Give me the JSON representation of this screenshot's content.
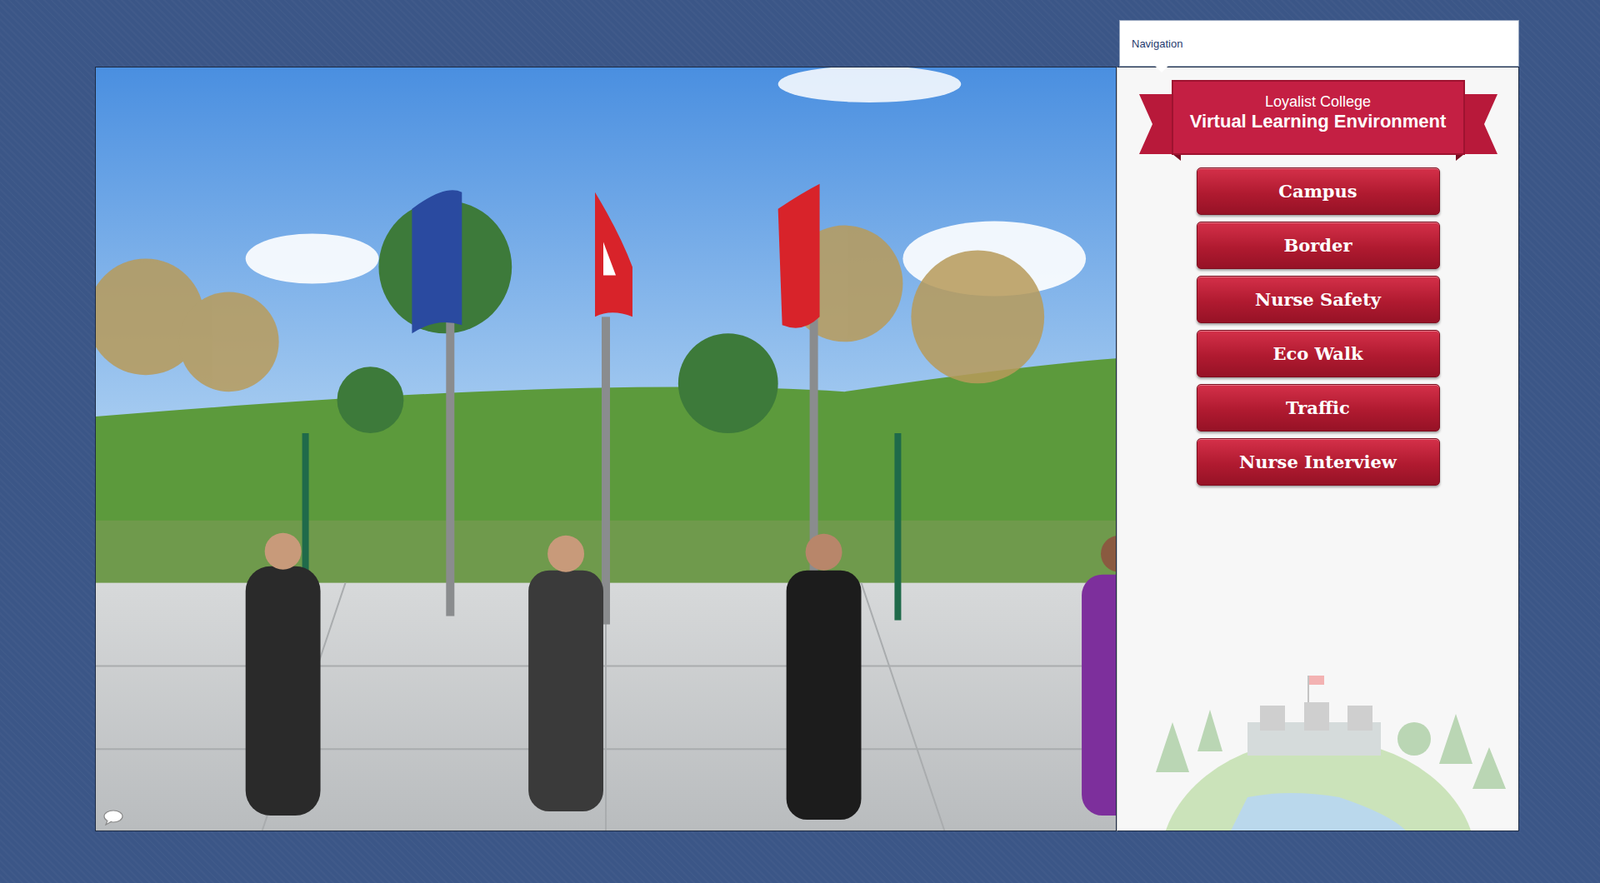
{
  "navigation": {
    "title": "Navigation"
  },
  "banner": {
    "subtitle": "Loyalist College",
    "title": "Virtual Learning Environment"
  },
  "buttons": [
    {
      "label": "Campus"
    },
    {
      "label": "Border"
    },
    {
      "label": "Nurse Safety"
    },
    {
      "label": "Eco Walk"
    },
    {
      "label": "Traffic"
    },
    {
      "label": "Nurse Interview"
    }
  ]
}
